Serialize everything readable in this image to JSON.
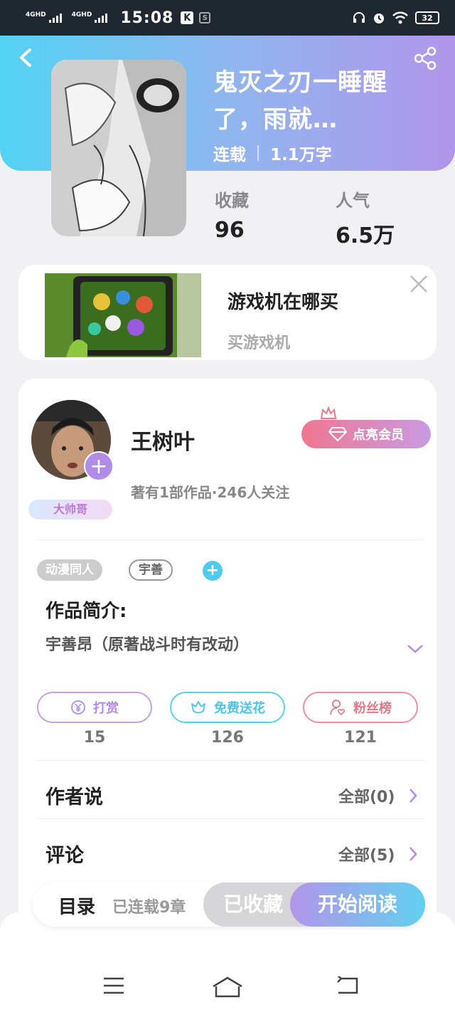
{
  "status_bar": {
    "signal1": "4GHD",
    "signal2": "4GHD",
    "time": "15:08",
    "k_badge": "K",
    "s_badge": "S",
    "battery": "32"
  },
  "book": {
    "title": "鬼灭之刃一睡醒了，雨就…",
    "status": "连载",
    "word_count": "1.1万字",
    "fav_label": "收藏",
    "fav_value": "96",
    "pop_label": "人气",
    "pop_value": "6.5万"
  },
  "ad": {
    "title": "游戏机在哪买",
    "subtitle": "买游戏机"
  },
  "author": {
    "name": "王树叶",
    "avatar_tag": "大帅哥",
    "vip_label": "点亮会员",
    "info": "著有1部作品·246人关注"
  },
  "tags": [
    "动漫同人",
    "宇善"
  ],
  "intro": {
    "heading": "作品简介:",
    "text": "宇善昂（原著战斗时有改动）"
  },
  "actions": [
    {
      "label": "打赏",
      "count": "15",
      "icon": "yen-icon"
    },
    {
      "label": "免费送花",
      "count": "126",
      "icon": "flower-icon"
    },
    {
      "label": "粉丝榜",
      "count": "121",
      "icon": "user-heart-icon"
    }
  ],
  "rows": {
    "author_says": {
      "title": "作者说",
      "all": "全部(0)"
    },
    "comments": {
      "title": "评论",
      "all": "全部(5)"
    }
  },
  "bottom_bar": {
    "toc": "目录",
    "chapters": "已连载9章",
    "favorited": "已收藏",
    "start_reading": "开始阅读"
  },
  "colors": {
    "header_start": "#52d3f2",
    "header_end": "#b196ea",
    "accent_purple": "#b28be9",
    "accent_cyan": "#4bc6ea",
    "accent_pink": "#e07a86"
  }
}
